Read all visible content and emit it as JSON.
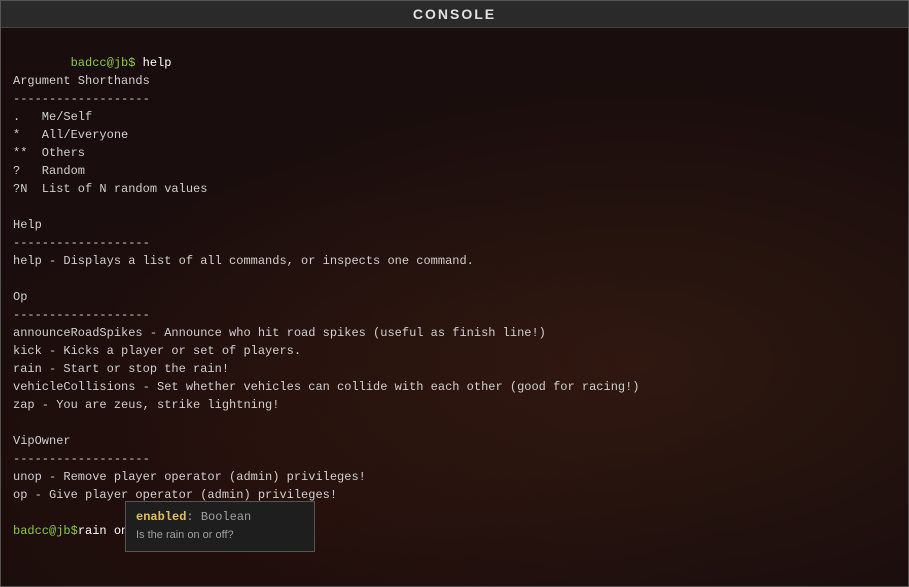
{
  "window": {
    "title": "CONSOLE"
  },
  "console": {
    "lines": [
      {
        "type": "prompt-cmd",
        "prompt": "badcc@jb$ ",
        "cmd": "help"
      },
      {
        "type": "text",
        "content": "Argument Shorthands"
      },
      {
        "type": "text",
        "content": "-------------------"
      },
      {
        "type": "text",
        "content": ".   Me/Self"
      },
      {
        "type": "text",
        "content": "*   All/Everyone"
      },
      {
        "type": "text",
        "content": "**  Others"
      },
      {
        "type": "text",
        "content": "?   Random"
      },
      {
        "type": "text",
        "content": "?N  List of N random values"
      },
      {
        "type": "blank"
      },
      {
        "type": "text",
        "content": "Help"
      },
      {
        "type": "text",
        "content": "-------------------"
      },
      {
        "type": "text",
        "content": "help - Displays a list of all commands, or inspects one command."
      },
      {
        "type": "blank"
      },
      {
        "type": "text",
        "content": "Op"
      },
      {
        "type": "text",
        "content": "-------------------"
      },
      {
        "type": "text",
        "content": "announceRoadSpikes - Announce who hit road spikes (useful as finish line!)"
      },
      {
        "type": "text",
        "content": "kick - Kicks a player or set of players."
      },
      {
        "type": "text",
        "content": "rain - Start or stop the rain!"
      },
      {
        "type": "text",
        "content": "vehicleCollisions - Set whether vehicles can collide with each other (good for racing!)"
      },
      {
        "type": "text",
        "content": "zap - You are zeus, strike lightning!"
      },
      {
        "type": "blank"
      },
      {
        "type": "text",
        "content": "VipOwner"
      },
      {
        "type": "text",
        "content": "-------------------"
      },
      {
        "type": "text",
        "content": "unop - Remove player operator (admin) privileges!"
      },
      {
        "type": "text",
        "content": "op - Give player operator (admin) privileges!"
      }
    ],
    "input": {
      "prompt": "badcc@jb$ ",
      "value": "rain on"
    },
    "autocomplete": {
      "param_name": "enabled",
      "param_type": ": Boolean",
      "description": "Is the rain on or off?"
    }
  }
}
